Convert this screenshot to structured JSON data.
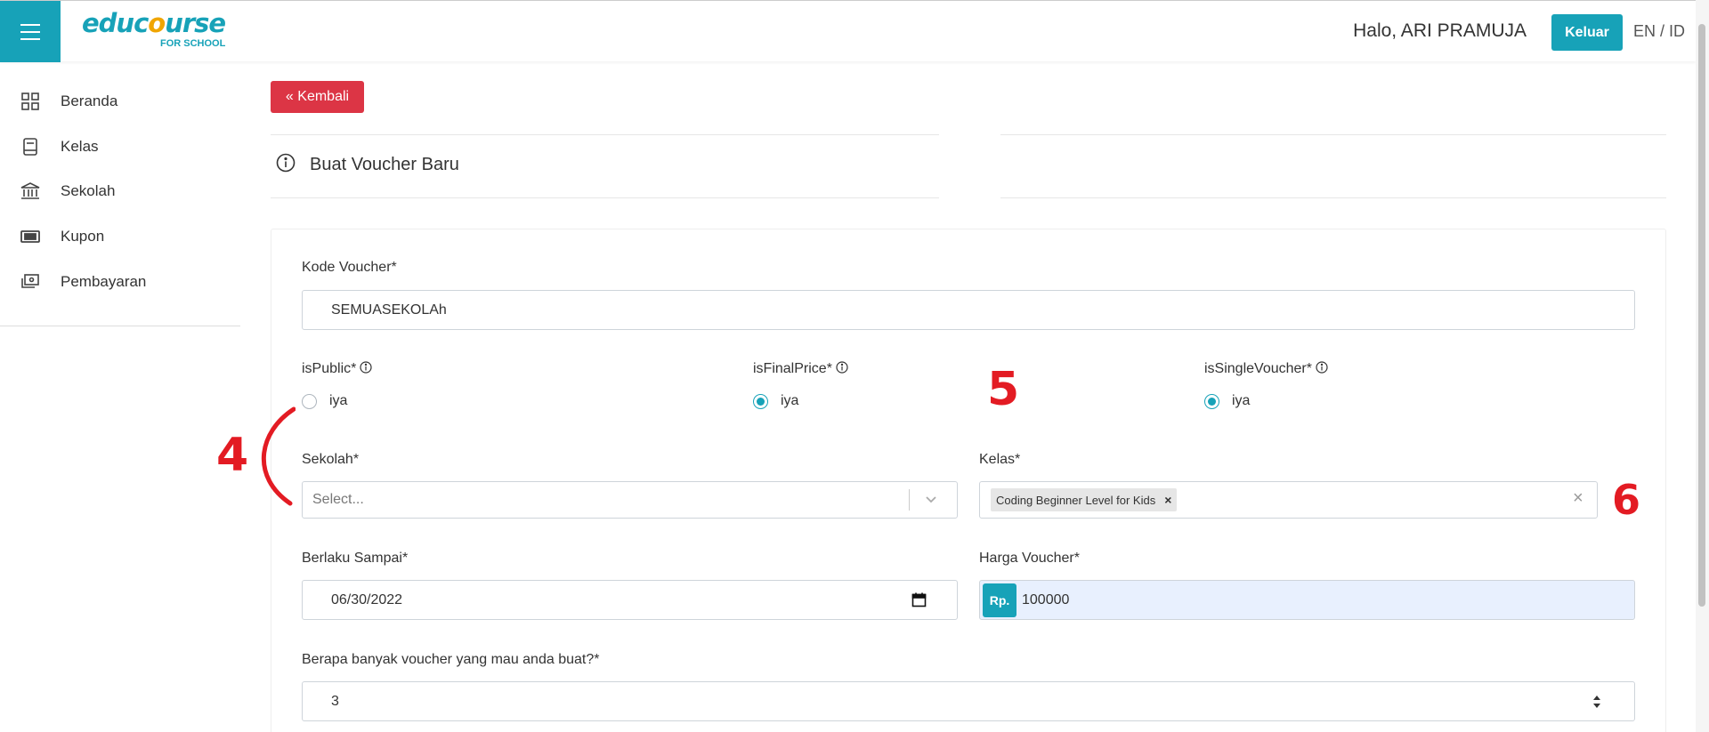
{
  "header": {
    "logo_text_left": "educ",
    "logo_text_o": "o",
    "logo_text_right": "urse",
    "logo_sub": "FOR SCHOOL",
    "greeting": "Halo, ARI PRAMUJA",
    "logout_label": "Keluar",
    "lang_label": "EN / ID",
    "accent_color": "#17a2b8"
  },
  "sidebar": {
    "items": [
      {
        "label": "Beranda",
        "icon": "dashboard-grid-icon"
      },
      {
        "label": "Kelas",
        "icon": "book-icon"
      },
      {
        "label": "Sekolah",
        "icon": "bank-building-icon"
      },
      {
        "label": "Kupon",
        "icon": "ticket-icon"
      },
      {
        "label": "Pembayaran",
        "icon": "payment-icon"
      }
    ]
  },
  "main": {
    "back_label": "« Kembali",
    "back_color": "#dc3545",
    "page_title": "Buat Voucher Baru",
    "form": {
      "kode_label": "Kode Voucher*",
      "kode_value": "SEMUASEKOLAh",
      "is_public_label": "isPublic*",
      "is_public_option": "iya",
      "is_public_checked": false,
      "is_final_label": "isFinalPrice*",
      "is_final_option": "iya",
      "is_final_checked": true,
      "is_single_label": "isSingleVoucher*",
      "is_single_option": "iya",
      "is_single_checked": true,
      "sekolah_label": "Sekolah*",
      "sekolah_placeholder": "Select...",
      "kelas_label": "Kelas*",
      "kelas_chip": "Coding Beginner Level for Kids",
      "kelas_chip_remove": "×",
      "kelas_clear": "×",
      "berlaku_label": "Berlaku Sampai*",
      "berlaku_value": "06/30/2022",
      "harga_label": "Harga Voucher*",
      "harga_prefix": "Rp.",
      "harga_value": "100000",
      "jumlah_label": "Berapa banyak voucher yang mau anda buat?*",
      "jumlah_value": "3"
    }
  },
  "annotations": {
    "a4": "4",
    "a5": "5",
    "a6": "6",
    "color": "#e31b23"
  }
}
